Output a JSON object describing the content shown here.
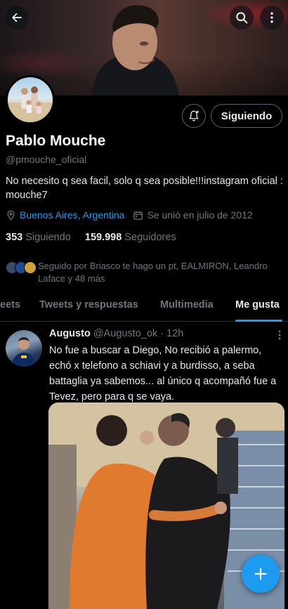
{
  "profile": {
    "name": "Pablo Mouche",
    "handle": "@pmouche_oficial",
    "bio": "No necesito q sea facil, solo q sea posible!!!instagram oficial : mouche7",
    "location": "Buenos Aires, Argentina",
    "joined": "Se unió en julio de 2012",
    "following_count": "353",
    "following_label": "Siguiendo",
    "followers_count": "159.998",
    "followers_label": "Seguidores",
    "followed_by": "Seguido por Briasco te hago un pt, EALMIRON, Leandro Laface y 48 más",
    "follow_button": "Siguiendo"
  },
  "tabs": [
    {
      "label": "eets"
    },
    {
      "label": "Tweets y respuestas"
    },
    {
      "label": "Multimedia"
    },
    {
      "label": "Me gusta",
      "active": true
    }
  ],
  "tweet": {
    "author": "Augusto",
    "handle": "@Augusto_ok",
    "time": "· 12h",
    "text": "No fue a buscar a Diego, No recibió a palermo, echó x telefono a schiavi y a burdisso, a seba battaglia ya sabemos... al único q acompañó fue a Tevez, pero para q se vaya."
  },
  "icons": {
    "back": "arrow-left-icon",
    "search": "search-icon",
    "more": "more-vertical-icon",
    "bell": "bell-plus-icon",
    "location": "location-pin-icon",
    "calendar": "calendar-icon",
    "compose": "plus-icon"
  },
  "colors": {
    "accent": "#1d9bf0",
    "muted": "#71767b",
    "background": "#000000",
    "text": "#e7e9ea"
  }
}
